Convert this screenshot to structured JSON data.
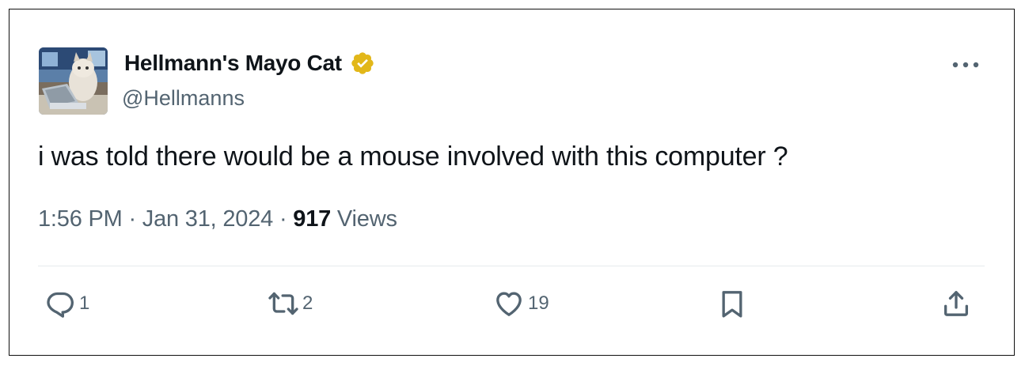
{
  "tweet": {
    "author": {
      "display_name": "Hellmann's Mayo Cat",
      "handle": "@Hellmanns",
      "verified": true,
      "verified_color": "#e2b719",
      "avatar_description": "cat-at-laptop-avatar"
    },
    "text": "i was told there would be a mouse involved with this computer ?",
    "meta": {
      "time": "1:56 PM",
      "separator": " · ",
      "date": "Jan 31, 2024",
      "views_count": "917",
      "views_label": " Views"
    },
    "actions": {
      "reply_count": "1",
      "retweet_count": "2",
      "like_count": "19"
    }
  },
  "icons": {
    "more": "more-horizontal-icon",
    "reply": "reply-icon",
    "retweet": "retweet-icon",
    "like": "heart-icon",
    "bookmark": "bookmark-icon",
    "share": "share-icon",
    "verified": "verified-badge-icon"
  },
  "colors": {
    "text_primary": "#0f1419",
    "text_secondary": "#536471",
    "divider": "#e6eaed",
    "border": "#111111"
  }
}
